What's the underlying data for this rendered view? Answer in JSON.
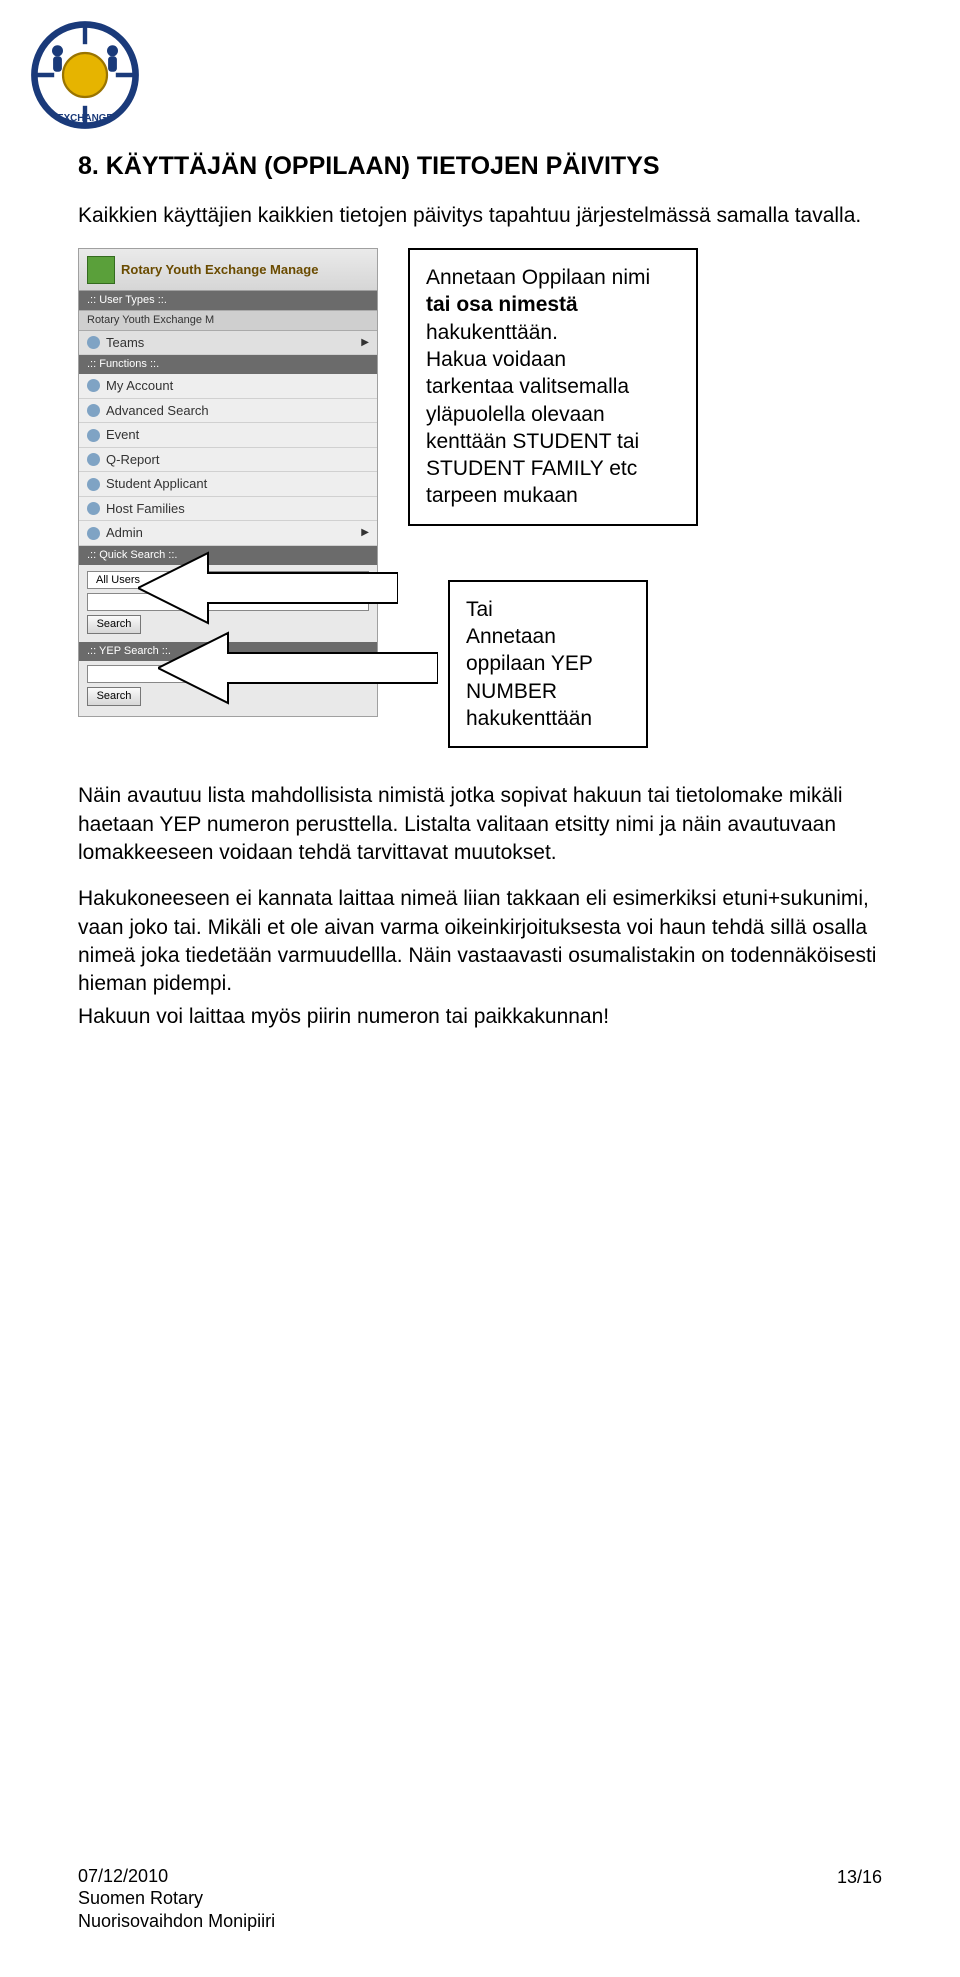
{
  "logo_alt": "Rotary Youth Exchange logo",
  "heading": "8.  KÄYTTÄJÄN (OPPILAAN) TIETOJEN PÄIVITYS",
  "intro": "Kaikkien käyttäjien kaikkien tietojen päivitys tapahtuu järjestelmässä samalla tavalla.",
  "panel": {
    "banner": "Rotary Youth Exchange Manage",
    "user_types_head": ".:: User Types ::.",
    "subbar": "Rotary Youth Exchange M",
    "teams": "Teams",
    "functions_head": ".:: Functions ::.",
    "my_account": "My Account",
    "advanced_search": "Advanced Search",
    "event": "Event",
    "q_report": "Q-Report",
    "student_applicant": "Student Applicant",
    "host_families": "Host Families",
    "admin": "Admin",
    "quick_search_head": ".:: Quick Search ::.",
    "all_users": "All Users",
    "search_btn": "Search",
    "yep_search_head": ".:: YEP Search ::.",
    "search_btn2": "Search"
  },
  "callout1_line1": "Annetaan Oppilaan nimi",
  "callout1_line2_bold": "tai osa nimestä",
  "callout1_line3": "hakukenttään.",
  "callout1_line4": "Hakua voidaan",
  "callout1_line5": "tarkentaa valitsemalla",
  "callout1_line6": "yläpuolella olevaan",
  "callout1_line7": "kenttään STUDENT tai",
  "callout1_line8": "STUDENT FAMILY etc",
  "callout1_line9": "tarpeen mukaan",
  "callout2_line1": "Tai",
  "callout2_line2": "Annetaan",
  "callout2_line3": "oppilaan YEP",
  "callout2_line4": "NUMBER",
  "callout2_line5": "hakukenttään",
  "body_p1": "Näin avautuu lista mahdollisista nimistä jotka sopivat hakuun tai tietolomake mikäli haetaan YEP numeron perusttella. Listalta valitaan etsitty nimi ja näin avautuvaan lomakkeeseen voidaan tehdä tarvittavat muutokset.",
  "body_p2": "Hakukoneeseen ei kannata laittaa nimeä liian takkaan eli esimerkiksi etuni+sukunimi, vaan joko tai. Mikäli et ole aivan varma oikeinkirjoituksesta voi haun tehdä sillä osalla nimeä joka tiedetään varmuudellla. Näin vastaavasti osumalistakin on todennäköisesti hieman pidempi.",
  "body_p3": "Hakuun voi laittaa myös piirin numeron tai paikkakunnan!",
  "footer_date": "07/12/2010",
  "footer_page": "13/16",
  "footer_org1": "Suomen Rotary",
  "footer_org2": "Nuorisovaihdon Monipiiri"
}
